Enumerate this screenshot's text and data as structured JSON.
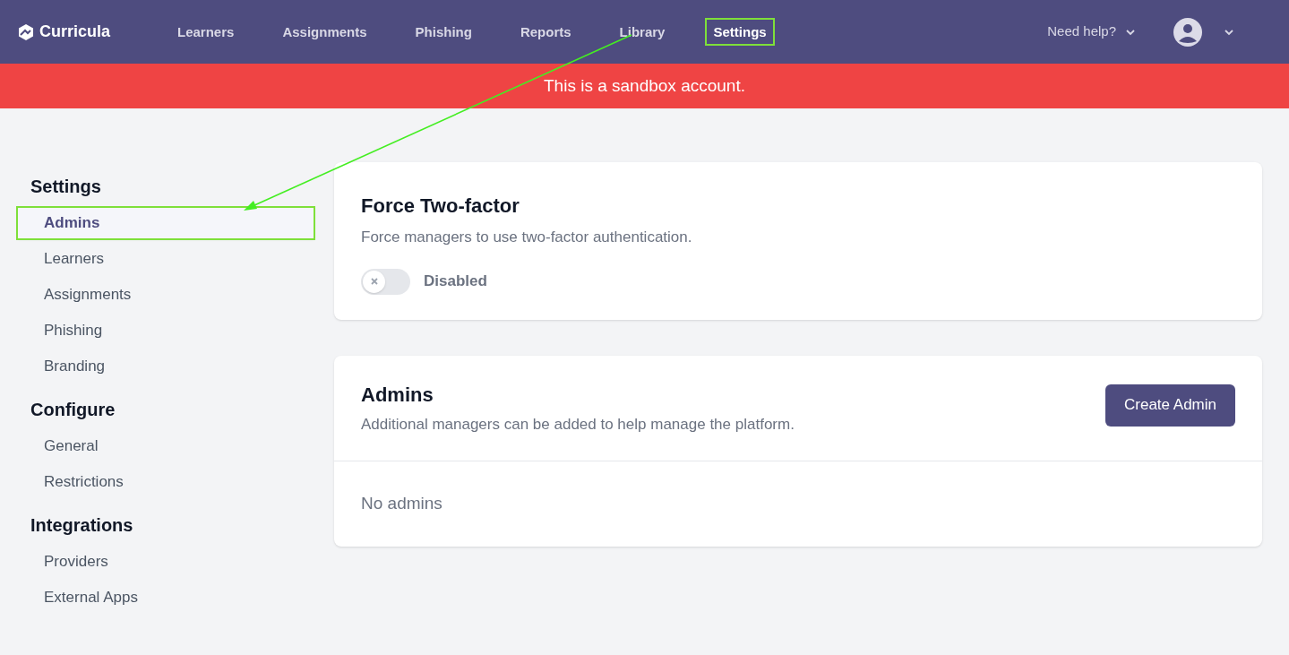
{
  "header": {
    "logo": "Curricula",
    "nav": [
      {
        "label": "Learners",
        "highlighted": false
      },
      {
        "label": "Assignments",
        "highlighted": false
      },
      {
        "label": "Phishing",
        "highlighted": false
      },
      {
        "label": "Reports",
        "highlighted": false
      },
      {
        "label": "Library",
        "highlighted": false
      },
      {
        "label": "Settings",
        "highlighted": true
      }
    ],
    "help": "Need help?"
  },
  "banner": "This is a sandbox account.",
  "sidebar": [
    {
      "heading": "Settings",
      "items": [
        {
          "label": "Admins",
          "selected": true,
          "highlighted": true
        },
        {
          "label": "Learners",
          "selected": false,
          "highlighted": false
        },
        {
          "label": "Assignments",
          "selected": false,
          "highlighted": false
        },
        {
          "label": "Phishing",
          "selected": false,
          "highlighted": false
        },
        {
          "label": "Branding",
          "selected": false,
          "highlighted": false
        }
      ]
    },
    {
      "heading": "Configure",
      "items": [
        {
          "label": "General",
          "selected": false,
          "highlighted": false
        },
        {
          "label": "Restrictions",
          "selected": false,
          "highlighted": false
        }
      ]
    },
    {
      "heading": "Integrations",
      "items": [
        {
          "label": "Providers",
          "selected": false,
          "highlighted": false
        },
        {
          "label": "External Apps",
          "selected": false,
          "highlighted": false
        }
      ]
    }
  ],
  "two_factor": {
    "title": "Force Two-factor",
    "description": "Force managers to use two-factor authentication.",
    "toggle": {
      "on": false,
      "label": "Disabled"
    }
  },
  "admins": {
    "title": "Admins",
    "description": "Additional managers can be added to help manage the platform.",
    "button": "Create Admin",
    "empty": "No admins"
  }
}
